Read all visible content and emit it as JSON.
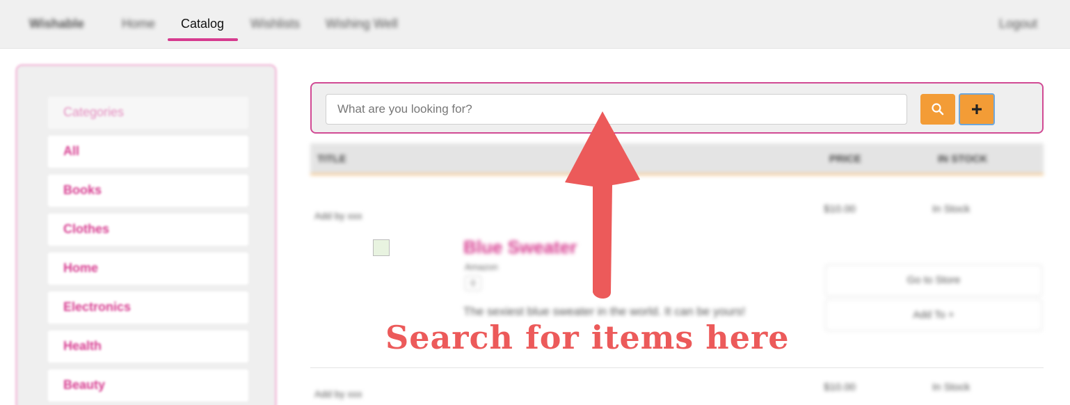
{
  "nav": {
    "brand": "Wishable",
    "items": [
      "Home",
      "Catalog",
      "Wishlists",
      "Wishing Well"
    ],
    "active": "Catalog",
    "logout": "Logout"
  },
  "sidebar": {
    "heading": "Categories",
    "items": [
      "All",
      "Books",
      "Clothes",
      "Home",
      "Electronics",
      "Health",
      "Beauty"
    ]
  },
  "search": {
    "placeholder": "What are you looking for?",
    "search_icon": "search-icon",
    "add_icon": "plus-icon"
  },
  "table": {
    "headers": [
      "TITLE",
      "PRICE",
      "IN STOCK"
    ],
    "rows": [
      {
        "added_by": "Add by xxx",
        "price": "$10.00",
        "stock": "In Stock",
        "title": "Blue Sweater",
        "subtitle": "Amazon",
        "qty": "0",
        "description": "The sexiest blue sweater in the world. It can be yours!",
        "actions": [
          "Go to Store",
          "Add To +"
        ]
      },
      {
        "added_by": "Add by xxx",
        "price": "$10.00",
        "stock": "In Stock"
      }
    ]
  },
  "annotation": {
    "text": "Search for items here",
    "color": "#ec5a5a"
  },
  "colors": {
    "accent_pink": "#d63b8f",
    "accent_orange": "#f39c36",
    "focus_blue": "#6da7dc"
  }
}
